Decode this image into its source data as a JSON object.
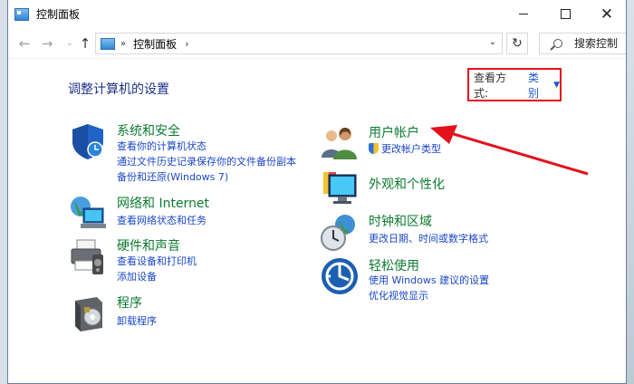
{
  "window": {
    "title": "控制面板"
  },
  "nav": {
    "back": "←",
    "forward": "→",
    "history": "⌄",
    "up": "↑",
    "breadcrumb_sep": "»",
    "location": "控制面板",
    "location_sep": "›",
    "dropdown": "⌄",
    "refresh": "↻"
  },
  "search": {
    "placeholder": "搜索控制"
  },
  "page": {
    "title": "调整计算机的设置"
  },
  "view": {
    "label": "查看方式:",
    "value": "类别",
    "caret": "▼"
  },
  "categories": [
    {
      "title": "系统和安全",
      "links": [
        "查看你的计算机状态",
        "通过文件历史记录保存你的文件备份副本",
        "备份和还原(Windows 7)"
      ]
    },
    {
      "title": "网络和 Internet",
      "links": [
        "查看网络状态和任务"
      ]
    },
    {
      "title": "硬件和声音",
      "links": [
        "查看设备和打印机",
        "添加设备"
      ]
    },
    {
      "title": "程序",
      "links": [
        "卸载程序"
      ]
    },
    {
      "title": "用户帐户",
      "links": [
        "更改帐户类型"
      ]
    },
    {
      "title": "外观和个性化",
      "links": []
    },
    {
      "title": "时钟和区域",
      "links": [
        "更改日期、时间或数字格式"
      ]
    },
    {
      "title": "轻松使用",
      "links": [
        "使用 Windows 建议的设置",
        "优化视觉显示"
      ]
    }
  ],
  "annotation": {
    "highlight_color": "#e2111c",
    "arrow_color": "#e2111c"
  }
}
